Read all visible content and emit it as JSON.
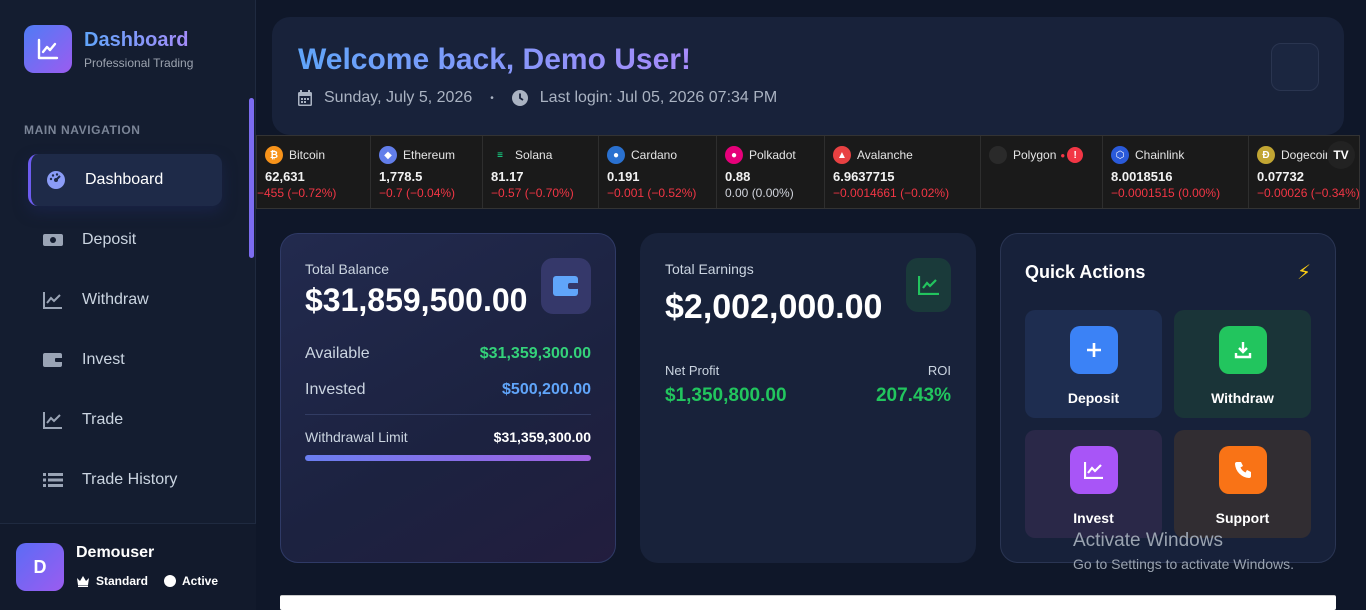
{
  "brand": {
    "title": "Dashboard",
    "subtitle": "Professional Trading"
  },
  "nav": {
    "heading": "MAIN NAVIGATION",
    "items": [
      {
        "label": "Dashboard",
        "icon": "gauge-icon",
        "active": true
      },
      {
        "label": "Deposit",
        "icon": "money-icon"
      },
      {
        "label": "Withdraw",
        "icon": "chart-line-icon"
      },
      {
        "label": "Invest",
        "icon": "wallet-icon"
      },
      {
        "label": "Trade",
        "icon": "chart-line-icon"
      },
      {
        "label": "Trade History",
        "icon": "list-icon"
      }
    ]
  },
  "user": {
    "initial": "D",
    "name": "Demouser",
    "plan": "Standard",
    "status": "Active"
  },
  "welcome": {
    "title": "Welcome back, Demo User!",
    "date": "Sunday, July 5, 2026",
    "separator": "•",
    "last_login": "Last login: Jul 05, 2026 07:34 PM"
  },
  "ticker": [
    {
      "name": "Bitcoin",
      "price": "62,631",
      "change": "−455 (−0.72%)",
      "color": "#f7931a",
      "glyph": "₿"
    },
    {
      "name": "Ethereum",
      "price": "1,778.5",
      "change": "−0.7 (−0.04%)",
      "color": "#627eea",
      "glyph": "◆"
    },
    {
      "name": "Solana",
      "price": "81.17",
      "change": "−0.57 (−0.70%)",
      "color": "#14f195",
      "glyph": "≡"
    },
    {
      "name": "Cardano",
      "price": "0.191",
      "change": "−0.001 (−0.52%)",
      "color": "#2a71d0",
      "glyph": "●"
    },
    {
      "name": "Polkadot",
      "price": "0.88",
      "change": "0.00 (0.00%)",
      "flat": true,
      "color": "#e6007a",
      "glyph": "●"
    },
    {
      "name": "Avalanche",
      "price": "6.9637715",
      "change": "−0.0014661 (−0.02%)",
      "color": "#e84142",
      "glyph": "▲"
    },
    {
      "name": "Polygon",
      "price": "",
      "change": "",
      "color": "#2a2a2a",
      "glyph": "",
      "alert": "!"
    },
    {
      "name": "Chainlink",
      "price": "8.0018516",
      "change": "−0.0001515 (0.00%)",
      "color": "#2a5ada",
      "glyph": "⬡"
    },
    {
      "name": "Dogecoin",
      "price": "0.07732",
      "change": "−0.00026 (−0.34%)",
      "color": "#c2a633",
      "glyph": "Ð"
    }
  ],
  "ticker_logo": "TV",
  "balance": {
    "label": "Total Balance",
    "amount": "$31,859,500.00",
    "available_label": "Available",
    "available": "$31,359,300.00",
    "invested_label": "Invested",
    "invested": "$500,200.00",
    "limit_label": "Withdrawal Limit",
    "limit": "$31,359,300.00"
  },
  "earnings": {
    "label": "Total Earnings",
    "amount": "$2,002,000.00",
    "profit_label": "Net Profit",
    "profit": "$1,350,800.00",
    "roi_label": "ROI",
    "roi": "207.43%"
  },
  "quick_actions": {
    "title": "Quick Actions",
    "buttons": [
      {
        "label": "Deposit",
        "icon": "plus-icon",
        "color": "#3b82f6",
        "bg": "#1e2d50"
      },
      {
        "label": "Withdraw",
        "icon": "download-icon",
        "color": "#22c55e",
        "bg": "#1a3438"
      },
      {
        "label": "Invest",
        "icon": "chart-line-icon",
        "color": "#a855f7",
        "bg": "#2a2848"
      },
      {
        "label": "Support",
        "icon": "phone-icon",
        "color": "#f97316",
        "bg": "#312d32"
      }
    ]
  },
  "watermark": {
    "line1": "Activate Windows",
    "line2": "Go to Settings to activate Windows."
  }
}
